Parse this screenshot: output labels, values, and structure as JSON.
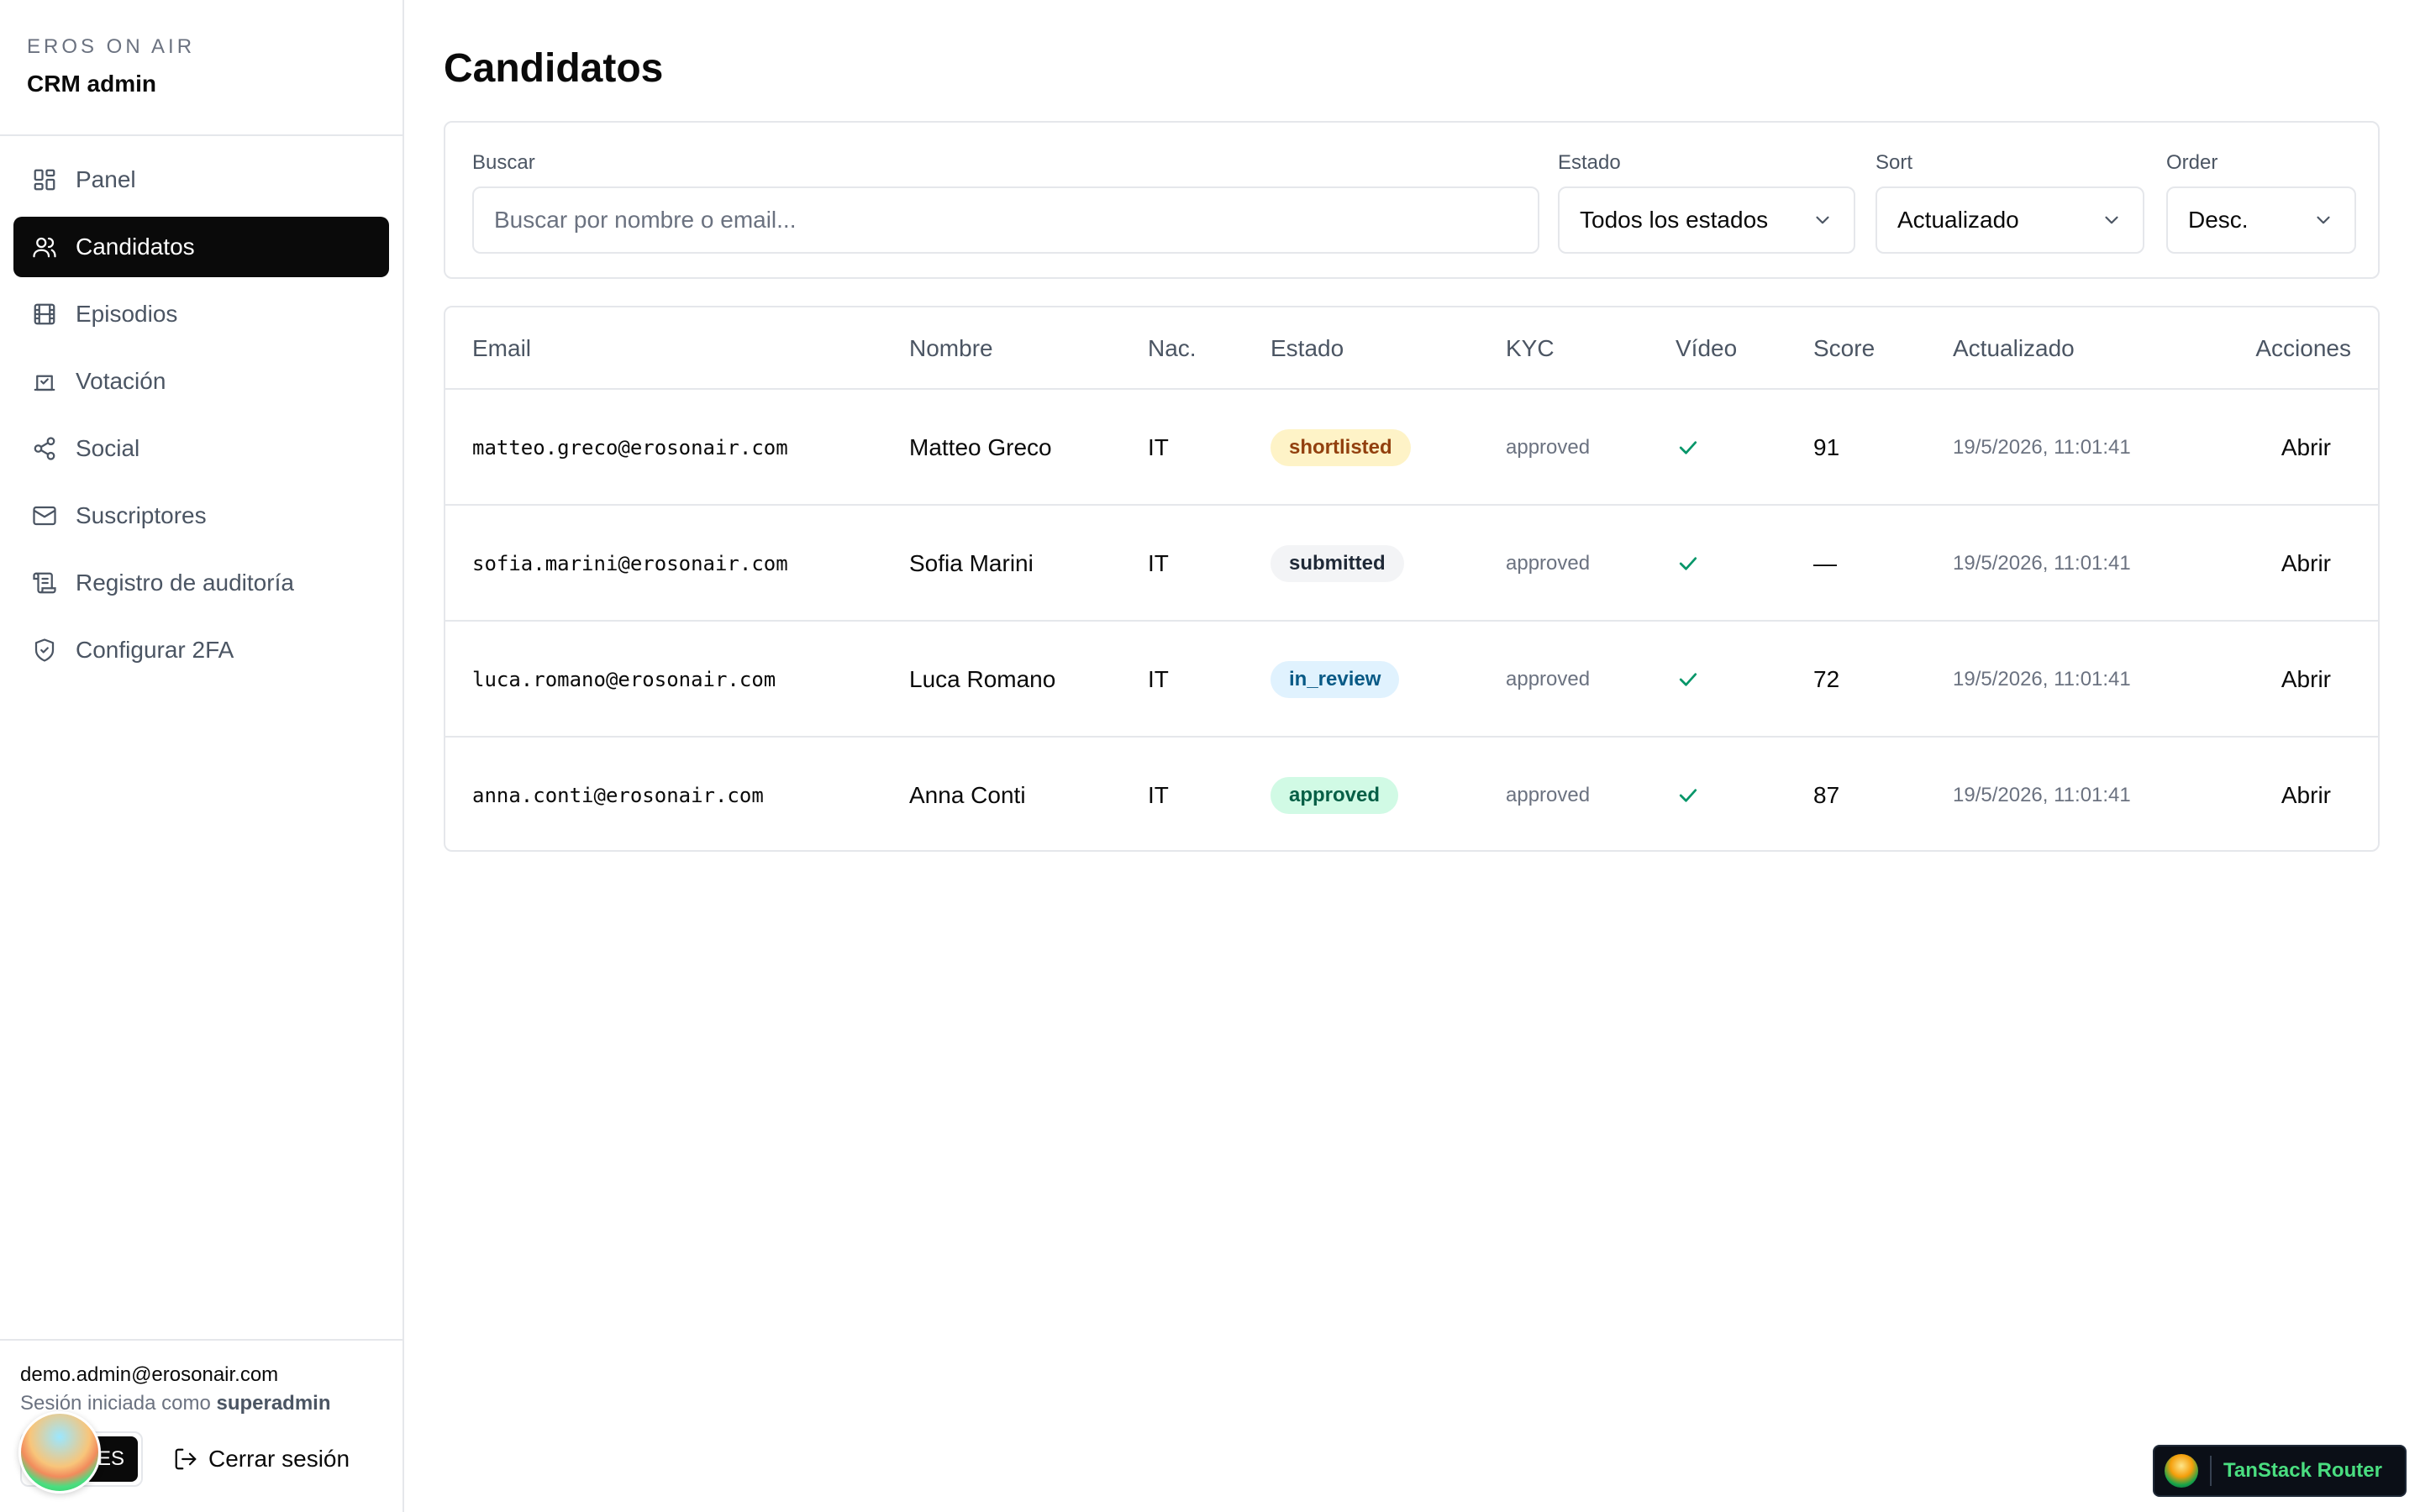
{
  "brand": {
    "eyebrow": "EROS ON AIR",
    "title": "CRM admin"
  },
  "nav": [
    {
      "label": "Panel",
      "icon": "dashboard-icon",
      "active": false
    },
    {
      "label": "Candidatos",
      "icon": "users-icon",
      "active": true
    },
    {
      "label": "Episodios",
      "icon": "film-icon",
      "active": false
    },
    {
      "label": "Votación",
      "icon": "vote-icon",
      "active": false
    },
    {
      "label": "Social",
      "icon": "share-icon",
      "active": false
    },
    {
      "label": "Suscriptores",
      "icon": "mail-icon",
      "active": false
    },
    {
      "label": "Registro de auditoría",
      "icon": "scroll-icon",
      "active": false
    },
    {
      "label": "Configurar 2FA",
      "icon": "shield-icon",
      "active": false
    }
  ],
  "user": {
    "email": "demo.admin@erosonair.com",
    "session_prefix": "Sesión iniciada como",
    "role": "superadmin"
  },
  "lang": {
    "options": [
      "EN",
      "ES"
    ],
    "active": "ES"
  },
  "logout_label": "Cerrar sesión",
  "page": {
    "title": "Candidatos"
  },
  "filters": {
    "search": {
      "label": "Buscar",
      "placeholder": "Buscar por nombre o email..."
    },
    "status": {
      "label": "Estado",
      "value": "Todos los estados"
    },
    "sort": {
      "label": "Sort",
      "value": "Actualizado"
    },
    "order": {
      "label": "Order",
      "value": "Desc."
    }
  },
  "table": {
    "headers": [
      "Email",
      "Nombre",
      "Nac.",
      "Estado",
      "KYC",
      "Vídeo",
      "Score",
      "Actualizado",
      "Acciones"
    ],
    "rows": [
      {
        "email": "matteo.greco@erosonair.com",
        "name": "Matteo Greco",
        "nat": "IT",
        "status": "shortlisted",
        "kyc": "approved",
        "video": "✓",
        "score": "91",
        "updated": "19/5/2026, 11:01:41",
        "action": "Abrir"
      },
      {
        "email": "sofia.marini@erosonair.com",
        "name": "Sofia Marini",
        "nat": "IT",
        "status": "submitted",
        "kyc": "approved",
        "video": "✓",
        "score": "—",
        "updated": "19/5/2026, 11:01:41",
        "action": "Abrir"
      },
      {
        "email": "luca.romano@erosonair.com",
        "name": "Luca Romano",
        "nat": "IT",
        "status": "in_review",
        "kyc": "approved",
        "video": "✓",
        "score": "72",
        "updated": "19/5/2026, 11:01:41",
        "action": "Abrir"
      },
      {
        "email": "anna.conti@erosonair.com",
        "name": "Anna Conti",
        "nat": "IT",
        "status": "approved",
        "kyc": "approved",
        "video": "✓",
        "score": "87",
        "updated": "19/5/2026, 11:01:41",
        "action": "Abrir"
      }
    ]
  },
  "status_colors": {
    "shortlisted": {
      "bg": "#fef3c7",
      "fg": "#92400e"
    },
    "submitted": {
      "bg": "#f3f4f6",
      "fg": "#1f2937"
    },
    "in_review": {
      "bg": "#e0f2fe",
      "fg": "#075985"
    },
    "approved": {
      "bg": "#d1fae5",
      "fg": "#065f46"
    }
  },
  "devtools": {
    "label": "TanStack Router"
  }
}
